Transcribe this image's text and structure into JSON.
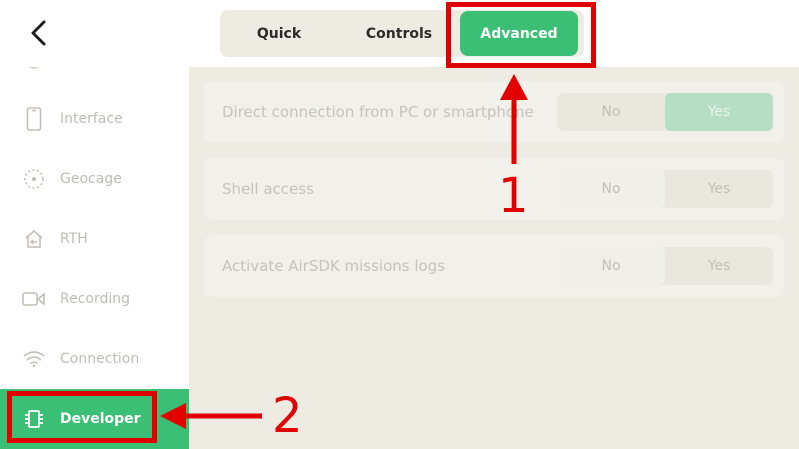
{
  "header": {
    "back_icon": "chevron-left-icon",
    "tabs": [
      {
        "label": "Quick",
        "active": false
      },
      {
        "label": "Controls",
        "active": false
      },
      {
        "label": "Advanced",
        "active": true
      }
    ]
  },
  "sidebar": {
    "items": [
      {
        "label": "Interface",
        "icon": "phone-icon",
        "active": false
      },
      {
        "label": "Geocage",
        "icon": "geocage-icon",
        "active": false
      },
      {
        "label": "RTH",
        "icon": "return-home-icon",
        "active": false
      },
      {
        "label": "Recording",
        "icon": "video-camera-icon",
        "active": false
      },
      {
        "label": "Connection",
        "icon": "wifi-icon",
        "active": false
      },
      {
        "label": "Developer",
        "icon": "chip-icon",
        "active": true
      }
    ]
  },
  "settings": [
    {
      "label": "Direct connection from PC or smartphone",
      "no": "No",
      "yes": "Yes",
      "selected": "Yes"
    },
    {
      "label": "Shell access",
      "no": "No",
      "yes": "Yes",
      "selected": "No"
    },
    {
      "label": "Activate AirSDK missions logs",
      "no": "No",
      "yes": "Yes",
      "selected": "No"
    }
  ],
  "annotations": {
    "label_1": "1",
    "label_2": "2",
    "color": "#e00000"
  },
  "colors": {
    "accent": "#3bbf74",
    "panel": "#eeebe3"
  }
}
